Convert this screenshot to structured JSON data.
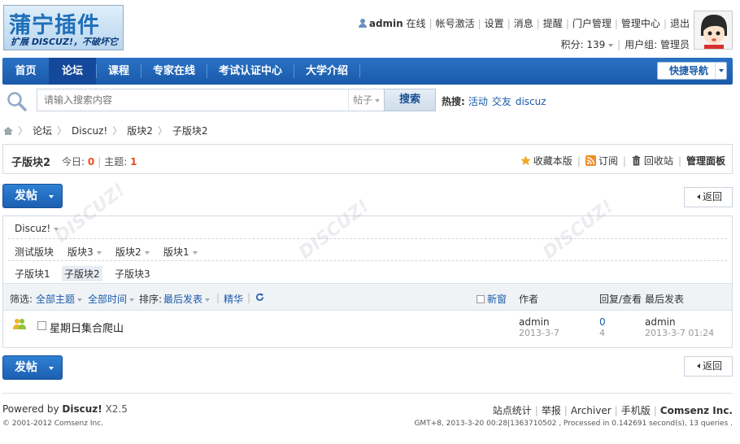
{
  "logo": {
    "title": "蒲宁插件",
    "tagline": "扩展 DISCUZ!，不破坏它"
  },
  "topbar": {
    "username": "admin",
    "status": "在线",
    "links": [
      "帐号激活",
      "设置",
      "消息",
      "提醒",
      "门户管理",
      "管理中心",
      "退出"
    ],
    "credits_label": "积分: 139",
    "usergroup_label": "用户组: 管理员"
  },
  "nav": {
    "items": [
      "首页",
      "论坛",
      "课程",
      "专家在线",
      "考试认证中心",
      "大学介绍"
    ],
    "active_index": 1,
    "quick_nav": "快捷导航"
  },
  "search": {
    "placeholder": "请输入搜索内容",
    "type": "帖子",
    "button": "搜索",
    "hot_label": "热搜:",
    "hot_terms": [
      "活动",
      "交友",
      "discuz"
    ]
  },
  "breadcrumb": [
    "论坛",
    "Discuz!",
    "版块2",
    "子版块2"
  ],
  "forum": {
    "name": "子版块2",
    "today_label": "今日:",
    "today_count": "0",
    "threads_label": "主题:",
    "threads_count": "1",
    "actions": {
      "favorite": "收藏本版",
      "subscribe": "订阅",
      "recycle": "回收站",
      "manage": "管理面板"
    }
  },
  "buttons": {
    "post": "发帖",
    "back": "返回"
  },
  "forum_nav": {
    "parent": "Discuz!",
    "row2": [
      "测试版块",
      "版块3",
      "版块2",
      "版块1"
    ],
    "row3": [
      "子版块1",
      "子版块2",
      "子版块3"
    ]
  },
  "filter": {
    "label": "筛选:",
    "all_topics": "全部主题",
    "all_time": "全部时间",
    "sort_label": "排序:",
    "sort_value": "最后发表",
    "digest": "精华",
    "new_window": "新窗",
    "col_author": "作者",
    "col_replies": "回复/查看",
    "col_last": "最后发表"
  },
  "threads": [
    {
      "subject": "星期日集合爬山",
      "author": "admin",
      "author_date": "2013-3-7",
      "replies": "0",
      "views": "4",
      "last_user": "admin",
      "last_date": "2013-3-7 01:24"
    }
  ],
  "footer": {
    "powered_prefix": "Powered by",
    "powered_brand": "Discuz!",
    "powered_version": "X2.5",
    "copyright": "© 2001-2012 Comsenz Inc.",
    "links": [
      "站点统计",
      "举报",
      "Archiver",
      "手机版"
    ],
    "company": "Comsenz Inc.",
    "info": "GMT+8, 2013-3-20 00:28|1363710502 , Processed in 0.142691 second(s), 13 queries ."
  },
  "colors": {
    "nav_blue": "#1a5aaa",
    "accent_red": "#e54f1f",
    "link_blue": "#1a5aaa"
  }
}
